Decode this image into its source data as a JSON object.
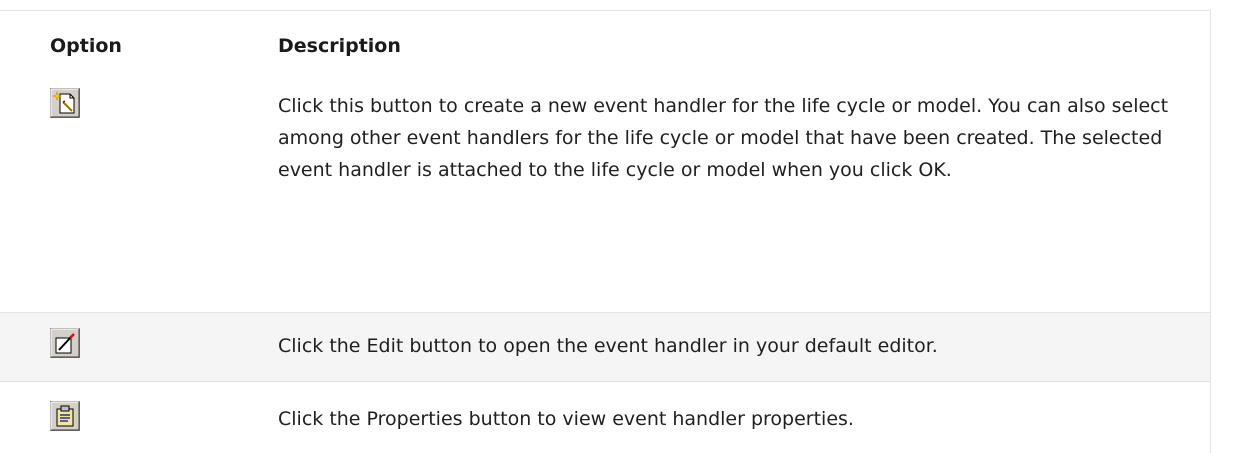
{
  "table": {
    "headers": {
      "option": "Option",
      "description": "Description"
    },
    "rows": [
      {
        "icon": "new-event-handler-icon",
        "description": "Click this button to create a new event handler for the life cycle or model. You can also select among other event handlers for the life cycle or model that have been created. The selected event handler is attached to the life cycle or model when you click OK."
      },
      {
        "icon": "edit-icon",
        "description": "Click the Edit button to open the event handler in your default editor."
      },
      {
        "icon": "properties-icon",
        "description": "Click the Properties button to view event handler properties."
      }
    ]
  }
}
